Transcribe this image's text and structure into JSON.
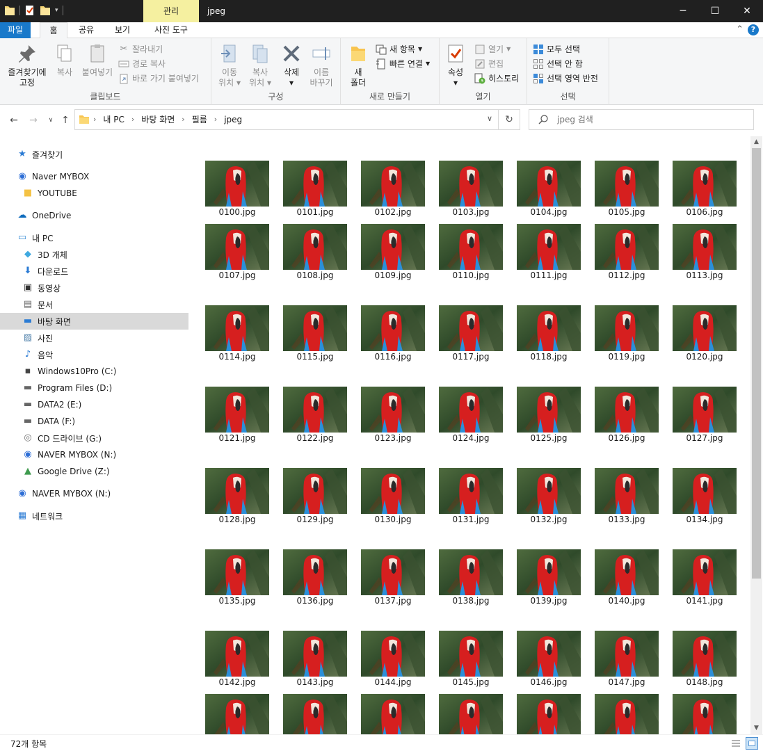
{
  "window": {
    "title": "jpeg",
    "context_tab": "관리",
    "controls": {
      "minimize": "─",
      "maximize": "☐",
      "close": "✕"
    }
  },
  "ribbon_tabs": {
    "file": "파일",
    "home": "홈",
    "share": "공유",
    "view": "보기",
    "picture_tools": "사진 도구",
    "help": "?"
  },
  "ribbon": {
    "clipboard": {
      "label": "클립보드",
      "pin_line1": "즐겨찾기에",
      "pin_line2": "고정",
      "copy": "복사",
      "paste": "붙여넣기",
      "cut": "잘라내기",
      "copy_path": "경로 복사",
      "paste_shortcut": "바로 가기 붙여넣기"
    },
    "organize": {
      "label": "구성",
      "move_line1": "이동",
      "move_line2": "위치",
      "copyto_line1": "복사",
      "copyto_line2": "위치",
      "delete": "삭제",
      "rename_line1": "이름",
      "rename_line2": "바꾸기"
    },
    "new": {
      "label": "새로 만들기",
      "folder_line1": "새",
      "folder_line2": "폴더",
      "new_item": "새 항목",
      "easy_access": "빠른 연결"
    },
    "open": {
      "label": "열기",
      "properties": "속성",
      "open": "열기",
      "edit": "편집",
      "history": "히스토리"
    },
    "select": {
      "label": "선택",
      "select_all": "모두 선택",
      "select_none": "선택 안 함",
      "invert": "선택 영역 반전"
    }
  },
  "address": {
    "crumbs": [
      "내 PC",
      "바탕 화면",
      "필름",
      "jpeg"
    ],
    "search_placeholder": "jpeg 검색"
  },
  "nav": {
    "items": [
      {
        "label": "즐겨찾기",
        "icon": "star-icon"
      },
      {
        "label": "Naver MYBOX",
        "icon": "naver-mybox-icon"
      },
      {
        "label": "YOUTUBE",
        "icon": "folder-icon"
      },
      {
        "label": "OneDrive",
        "icon": "cloud-icon"
      },
      {
        "label": "내 PC",
        "icon": "pc-icon"
      },
      {
        "label": "3D 개체",
        "icon": "cube-icon"
      },
      {
        "label": "다운로드",
        "icon": "download-icon"
      },
      {
        "label": "동영상",
        "icon": "video-icon"
      },
      {
        "label": "문서",
        "icon": "document-icon"
      },
      {
        "label": "바탕 화면",
        "icon": "desktop-icon"
      },
      {
        "label": "사진",
        "icon": "pictures-icon"
      },
      {
        "label": "음악",
        "icon": "music-icon"
      },
      {
        "label": "Windows10Pro (C:)",
        "icon": "windows-drive-icon"
      },
      {
        "label": "Program Files (D:)",
        "icon": "drive-icon"
      },
      {
        "label": "DATA2 (E:)",
        "icon": "drive-icon"
      },
      {
        "label": "DATA (F:)",
        "icon": "drive-icon"
      },
      {
        "label": "CD 드라이브 (G:)",
        "icon": "cd-drive-icon"
      },
      {
        "label": "NAVER MYBOX (N:)",
        "icon": "naver-mybox-icon"
      },
      {
        "label": "Google Drive (Z:)",
        "icon": "google-drive-icon"
      },
      {
        "label": "NAVER MYBOX (N:)",
        "icon": "naver-mybox-icon"
      },
      {
        "label": "네트워크",
        "icon": "network-icon"
      }
    ],
    "selected": "바탕 화면"
  },
  "files": [
    "0100.jpg",
    "0101.jpg",
    "0102.jpg",
    "0103.jpg",
    "0104.jpg",
    "0105.jpg",
    "0106.jpg",
    "0107.jpg",
    "0108.jpg",
    "0109.jpg",
    "0110.jpg",
    "0111.jpg",
    "0112.jpg",
    "0113.jpg",
    "0114.jpg",
    "0115.jpg",
    "0116.jpg",
    "0117.jpg",
    "0118.jpg",
    "0119.jpg",
    "0120.jpg",
    "0121.jpg",
    "0122.jpg",
    "0123.jpg",
    "0124.jpg",
    "0125.jpg",
    "0126.jpg",
    "0127.jpg",
    "0128.jpg",
    "0129.jpg",
    "0130.jpg",
    "0131.jpg",
    "0132.jpg",
    "0133.jpg",
    "0134.jpg",
    "0135.jpg",
    "0136.jpg",
    "0137.jpg",
    "0138.jpg",
    "0139.jpg",
    "0140.jpg",
    "0141.jpg",
    "0142.jpg",
    "0143.jpg",
    "0144.jpg",
    "0145.jpg",
    "0146.jpg",
    "0147.jpg",
    "0148.jpg",
    "",
    "",
    "",
    "",
    "",
    "",
    ""
  ],
  "status": {
    "item_count": "72개 항목"
  },
  "colors": {
    "accent": "#1979ca",
    "context_tab": "#f5f0a0",
    "titlebar": "#202020",
    "selection": "#d9d9d9"
  }
}
